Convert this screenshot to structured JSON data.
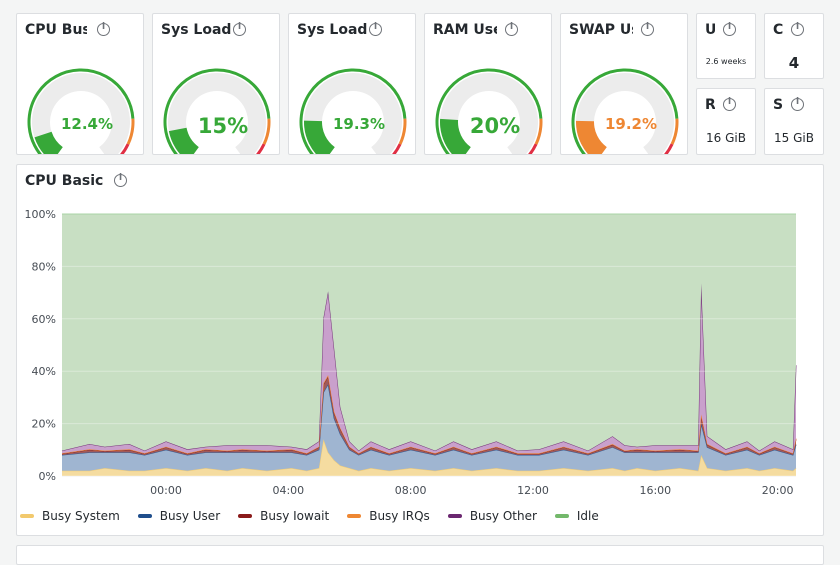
{
  "gauges": [
    {
      "title": "CPU Busy",
      "value_text": "12.4%",
      "value": 12.4,
      "color": "#37a838"
    },
    {
      "title": "Sys Load",
      "value_text": "15%",
      "value": 15,
      "color": "#37a838"
    },
    {
      "title": "Sys Load",
      "value_text": "19.3%",
      "value": 19.3,
      "color": "#37a838"
    },
    {
      "title": "RAM Used",
      "value_text": "20%",
      "value": 20,
      "color": "#37a838"
    },
    {
      "title": "SWAP Used",
      "value_text": "19.2%",
      "value": 19.2,
      "color": "#ee8733"
    }
  ],
  "stats": [
    {
      "title": "Uptime",
      "value": "2.6 weeks"
    },
    {
      "title": "CPU Cores",
      "value": "4"
    },
    {
      "title": "RootFS Total",
      "value": "16 GiB"
    },
    {
      "title": "SWAP Total",
      "value": "15 GiB"
    }
  ],
  "cpu_panel": {
    "title": "CPU Basic",
    "legend": [
      {
        "name": "Busy System",
        "color": "#f2c96d"
      },
      {
        "name": "Busy User",
        "color": "#1f4e8c"
      },
      {
        "name": "Busy Iowait",
        "color": "#8a1a1a"
      },
      {
        "name": "Busy IRQs",
        "color": "#ee8733"
      },
      {
        "name": "Busy Other",
        "color": "#6b2770"
      },
      {
        "name": "Idle",
        "color": "#73b86b"
      }
    ]
  },
  "chart_data": {
    "type": "area",
    "title": "CPU Basic",
    "y_ticks": [
      "0%",
      "20%",
      "40%",
      "60%",
      "80%",
      "100%"
    ],
    "x_ticks": [
      "00:00",
      "04:00",
      "08:00",
      "12:00",
      "16:00",
      "20:00"
    ],
    "ylim": [
      0,
      100
    ],
    "stacked": true,
    "grid": true,
    "legend_position": "bottom",
    "x_hours": [
      -3.4,
      -2.5,
      -2,
      -1.2,
      -0.7,
      0,
      0.7,
      1.3,
      2,
      2.5,
      3.3,
      4.1,
      4.6,
      5,
      5.15,
      5.3,
      5.5,
      5.7,
      6,
      6.3,
      6.7,
      7.3,
      8,
      8.8,
      9.4,
      10,
      10.8,
      11.5,
      12.2,
      13,
      13.8,
      14.6,
      15,
      15.4,
      16,
      16.8,
      17.4,
      17.5,
      17.7,
      18.3,
      19,
      19.4,
      19.9,
      20.5,
      20.6
    ],
    "series": [
      {
        "name": "Busy System",
        "values": [
          2,
          2,
          3,
          2,
          2,
          3,
          2,
          3,
          2,
          3,
          2,
          3,
          2,
          3,
          14,
          9,
          6,
          4,
          3,
          2,
          3,
          2,
          3,
          2,
          3,
          2,
          3,
          2,
          2,
          3,
          2,
          3,
          2,
          3,
          2,
          3,
          2,
          8,
          3,
          2,
          3,
          2,
          3,
          2,
          3
        ]
      },
      {
        "name": "Busy User",
        "values": [
          6,
          7,
          6,
          7,
          6,
          7,
          6,
          6,
          7,
          6,
          7,
          6,
          6,
          7,
          18,
          26,
          16,
          12,
          7,
          6,
          7,
          6,
          7,
          6,
          7,
          6,
          7,
          6,
          6,
          7,
          6,
          8,
          7,
          6,
          7,
          6,
          7,
          12,
          8,
          6,
          7,
          6,
          7,
          6,
          9
        ]
      },
      {
        "name": "Busy Iowait",
        "values": [
          0.5,
          1,
          0.5,
          1,
          0.5,
          1,
          0.5,
          1,
          0.5,
          1,
          0.5,
          1,
          0.5,
          1,
          3,
          3,
          2,
          2,
          1,
          0.5,
          1,
          0.5,
          1,
          0.5,
          1,
          0.5,
          1,
          0.5,
          0.5,
          1,
          0.5,
          1,
          0.5,
          1,
          0.5,
          1,
          0.5,
          3,
          1,
          0.5,
          1,
          0.5,
          1,
          0.5,
          2
        ]
      },
      {
        "name": "Busy IRQs",
        "values": [
          0.2,
          0.2,
          0.2,
          0.2,
          0.2,
          0.2,
          0.2,
          0.2,
          0.2,
          0.2,
          0.2,
          0.2,
          0.2,
          0.2,
          0.5,
          0.5,
          0.5,
          0.3,
          0.2,
          0.2,
          0.2,
          0.2,
          0.2,
          0.2,
          0.2,
          0.2,
          0.2,
          0.2,
          0.2,
          0.2,
          0.2,
          0.2,
          0.2,
          0.2,
          0.2,
          0.2,
          0.2,
          0.5,
          0.2,
          0.2,
          0.2,
          0.2,
          0.2,
          0.2,
          0.3
        ]
      },
      {
        "name": "Busy Other",
        "values": [
          1,
          2,
          1.5,
          2,
          1,
          2,
          1.5,
          1,
          2,
          1.5,
          2,
          1,
          1.5,
          2,
          25,
          32,
          24,
          8,
          2,
          1,
          2,
          1.5,
          2,
          1,
          2,
          1.5,
          2,
          1,
          1.5,
          2,
          1,
          3,
          2,
          1,
          2,
          1.5,
          2,
          50,
          3,
          1.5,
          2,
          1,
          2,
          1.5,
          28
        ]
      },
      {
        "name": "Idle",
        "values": [
          90.3,
          87.8,
          88.8,
          87.8,
          90.3,
          86.8,
          89.8,
          88.8,
          88.3,
          88.3,
          88.3,
          88.8,
          89.8,
          86.8,
          39.5,
          29.5,
          51.5,
          73.7,
          86.8,
          90.3,
          86.8,
          89.8,
          86.8,
          90.3,
          86.8,
          89.8,
          86.8,
          90.3,
          89.8,
          86.8,
          90.3,
          84.8,
          88.3,
          88.8,
          88.3,
          88.3,
          88.3,
          26.5,
          84.8,
          89.8,
          86.8,
          90.3,
          86.8,
          89.8,
          57.7
        ]
      }
    ]
  }
}
